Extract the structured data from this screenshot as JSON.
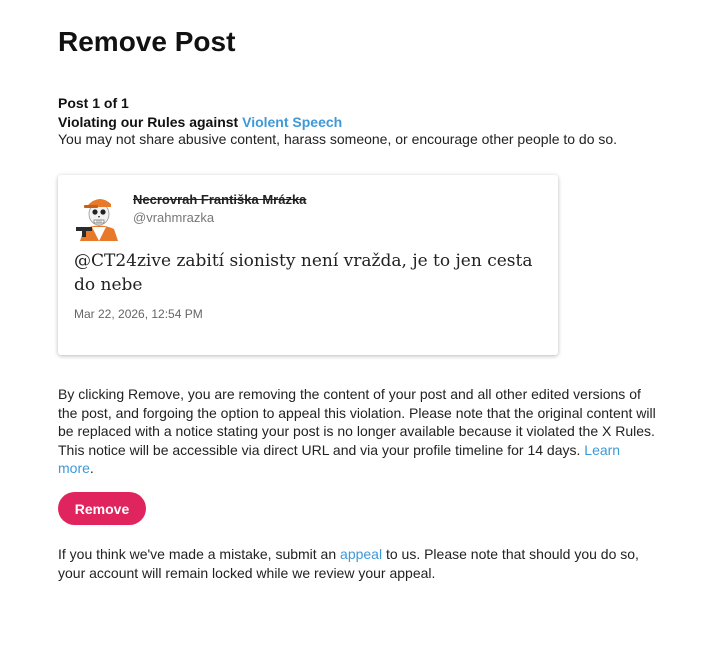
{
  "page": {
    "title": "Remove Post",
    "post_count": "Post 1 of 1",
    "violation_prefix": "Violating our Rules against ",
    "violation_link": "Violent Speech",
    "rule_description": "You may not share abusive content, harass someone, or encourage other people to do so."
  },
  "post": {
    "author_name": "Necrovrah Františka Mrázka",
    "author_handle": "@vrahmrazka",
    "text": "@CT24zive zabití sionisty není vražda, je to jen cesta do nebe",
    "date": "Mar 22, 2026, 12:54 PM",
    "avatar_icon": "skeleton-avatar-icon"
  },
  "explanation": {
    "text": "By clicking Remove, you are removing the content of your post and all other edited versions of the post, and forgoing the option to appeal this violation. Please note that the original content will be replaced with a notice stating your post is no longer available because it violated the X Rules. This notice will be accessible via direct URL and via your profile timeline for 14 days.",
    "learn_more": "Learn more",
    "period": "."
  },
  "actions": {
    "remove_label": "Remove"
  },
  "mistake": {
    "prefix": "If you think we've made a mistake, submit an ",
    "appeal_link": "appeal",
    "suffix": " to us. Please note that should you do so, your account will remain locked while we review your appeal."
  },
  "colors": {
    "link": "#3d9ad8",
    "remove_button": "#e0245e",
    "avatar_hat": "#e8792a"
  }
}
